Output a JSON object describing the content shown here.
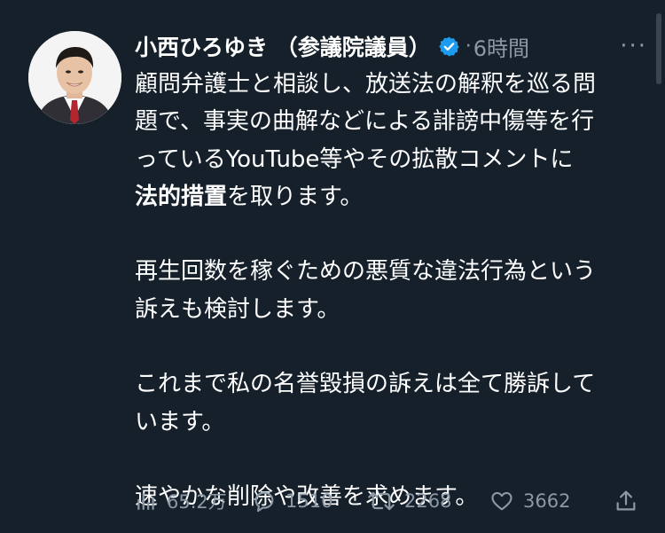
{
  "tweet": {
    "author_name": "小西ひろゆき （参議院議員）",
    "dot": "·",
    "time": "6時間",
    "more": "···",
    "paragraphs": [
      {
        "lines": [
          "顧問弁護士と相談し、放送法の解釈を巡る問",
          "題で、事実の曲解などによる誹謗中傷等を行",
          "っているYouTube等やその拡散コメントに"
        ],
        "bold_part": "法的措置",
        "after_bold": "を取ります。"
      },
      {
        "lines": [
          "再生回数を稼ぐための悪質な違法行為という",
          "訴えも検討します。"
        ]
      },
      {
        "lines": [
          "これまで私の名誉毀損の訴えは全て勝訴して",
          "います。"
        ]
      },
      {
        "lines": [
          "速やかな削除や改善を求めます。"
        ]
      }
    ]
  },
  "actions": {
    "views": "65.2万",
    "replies": "1510",
    "retweets": "2268",
    "likes": "3662"
  },
  "icons": {
    "views": "bar-chart-icon",
    "reply": "speech-bubble-icon",
    "retweet": "retweet-icon",
    "like": "heart-icon",
    "share": "share-icon",
    "verified": "verified-badge-icon"
  },
  "colors": {
    "background": "#15202b",
    "text": "#ffffff",
    "muted": "#8b98a5",
    "verified": "#1d9bf0"
  }
}
